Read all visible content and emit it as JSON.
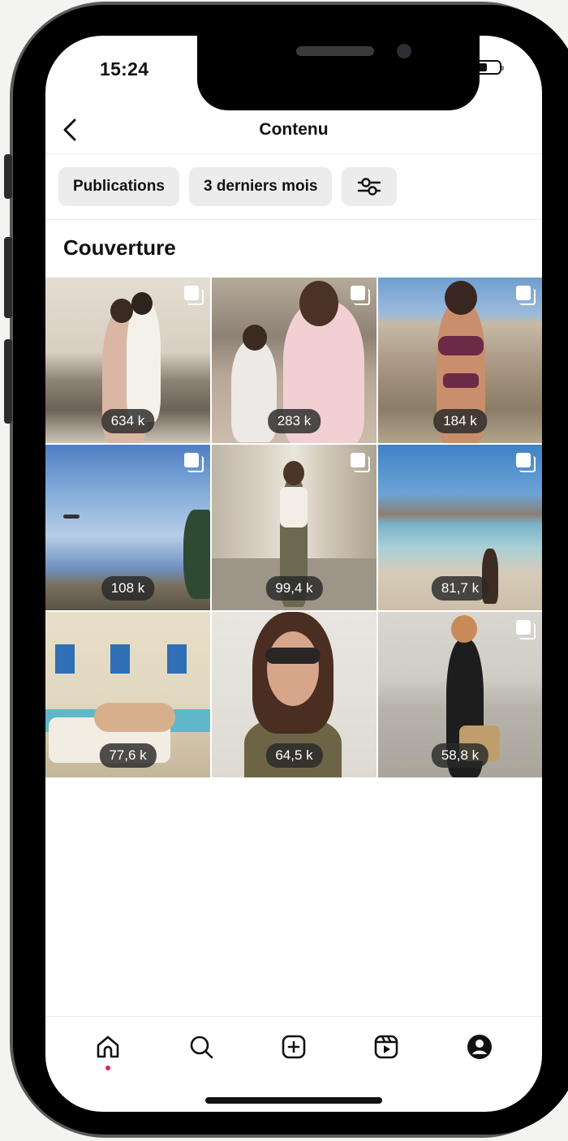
{
  "status_bar": {
    "time": "15:24"
  },
  "header": {
    "title": "Contenu",
    "back_icon": "chevron-left-icon"
  },
  "filters": [
    {
      "label": "Publications"
    },
    {
      "label": "3 derniers mois"
    }
  ],
  "filter_settings_icon": "sliders-icon",
  "section": {
    "title": "Couverture"
  },
  "posts": [
    {
      "reach": "634 k",
      "scene": "beach couple"
    },
    {
      "reach": "283 k",
      "scene": "pregnant woman with child"
    },
    {
      "reach": "184 k",
      "scene": "bikini on rocks"
    },
    {
      "reach": "108 k",
      "scene": "blue sky with plane"
    },
    {
      "reach": "99,4 k",
      "scene": "street portrait"
    },
    {
      "reach": "81,7 k",
      "scene": "beach with child"
    },
    {
      "reach": "77,6 k",
      "scene": "blue shutters lounge"
    },
    {
      "reach": "64,5 k",
      "scene": "sunglasses selfie"
    },
    {
      "reach": "58,8 k",
      "scene": "black dress with basket"
    }
  ],
  "bottom_nav": [
    {
      "icon": "home-icon",
      "active": true
    },
    {
      "icon": "search-icon"
    },
    {
      "icon": "add-post-icon"
    },
    {
      "icon": "reels-icon"
    },
    {
      "icon": "profile-icon"
    }
  ],
  "colors": {
    "active_dot": "#e0245e",
    "chip_bg": "#ececec",
    "badge_bg": "#282828"
  }
}
